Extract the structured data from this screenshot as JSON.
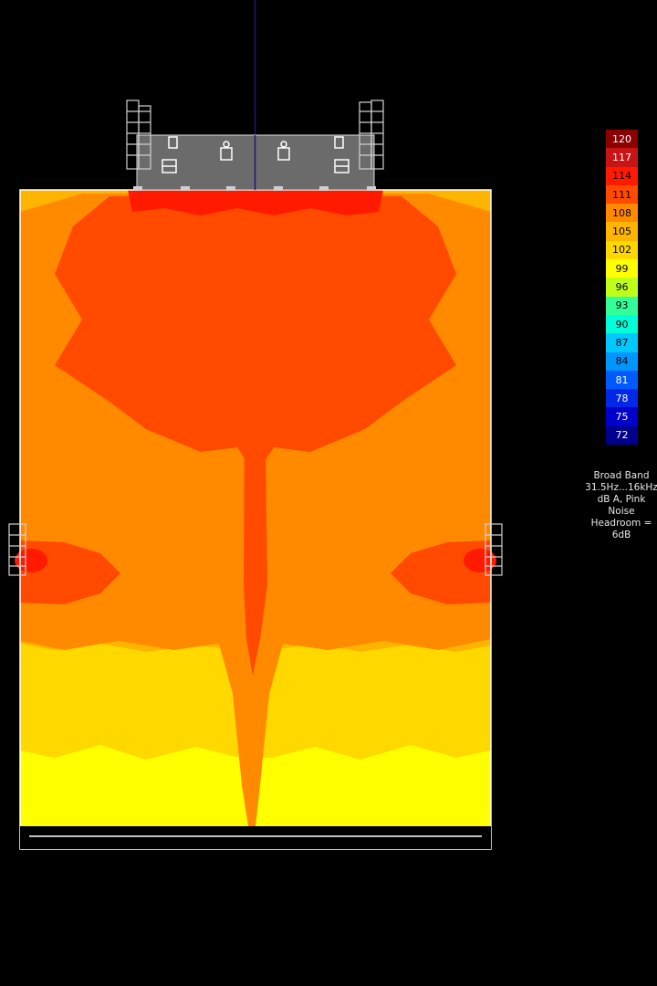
{
  "colors": {
    "background": "#000000",
    "outline": "#ffffff",
    "axis": "#1a1a7a",
    "rigs": "#cfcfcf",
    "stage_deck": "#6b6b6b"
  },
  "legend": {
    "unit": "dB",
    "levels": [
      {
        "label": "120",
        "color": "#8b0000",
        "text_color": "#ffffff"
      },
      {
        "label": "117",
        "color": "#c81414",
        "text_color": "#ffffff"
      },
      {
        "label": "114",
        "color": "#ff1a00",
        "text_color": "#000000"
      },
      {
        "label": "111",
        "color": "#ff4a00",
        "text_color": "#000000"
      },
      {
        "label": "108",
        "color": "#ff8a00",
        "text_color": "#000000"
      },
      {
        "label": "105",
        "color": "#ffb400",
        "text_color": "#000000"
      },
      {
        "label": "102",
        "color": "#ffd800",
        "text_color": "#000000"
      },
      {
        "label": "99",
        "color": "#ffff00",
        "text_color": "#000000"
      },
      {
        "label": "96",
        "color": "#c0ff1a",
        "text_color": "#000000"
      },
      {
        "label": "93",
        "color": "#33ff99",
        "text_color": "#000000"
      },
      {
        "label": "90",
        "color": "#00ffd8",
        "text_color": "#000000"
      },
      {
        "label": "87",
        "color": "#00c8ff",
        "text_color": "#000000"
      },
      {
        "label": "84",
        "color": "#0096ff",
        "text_color": "#000000"
      },
      {
        "label": "81",
        "color": "#005aff",
        "text_color": "#ffffff"
      },
      {
        "label": "78",
        "color": "#0028e6",
        "text_color": "#ffffff"
      },
      {
        "label": "75",
        "color": "#0000c8",
        "text_color": "#ffffff"
      },
      {
        "label": "72",
        "color": "#00008c",
        "text_color": "#ffffff"
      }
    ]
  },
  "info": {
    "line1": "Broad Band",
    "line2": "31.5Hz...16kHz",
    "line3": "dB A, Pink",
    "line4": "Noise",
    "line5": "Headroom =",
    "line6": "6dB"
  },
  "map_zones": [
    {
      "name": "room-floor",
      "level": "105"
    },
    {
      "name": "rear-floor",
      "level": "102"
    },
    {
      "name": "back-wall-zone",
      "level": "99"
    },
    {
      "name": "main-field",
      "level": "108"
    },
    {
      "name": "front-coverage",
      "level": "111"
    },
    {
      "name": "centre-seam",
      "level": "111"
    },
    {
      "name": "delay-left-coverage",
      "level": "111"
    },
    {
      "name": "delay-right-coverage",
      "level": "111"
    },
    {
      "name": "stage-lip",
      "level": "114"
    }
  ]
}
